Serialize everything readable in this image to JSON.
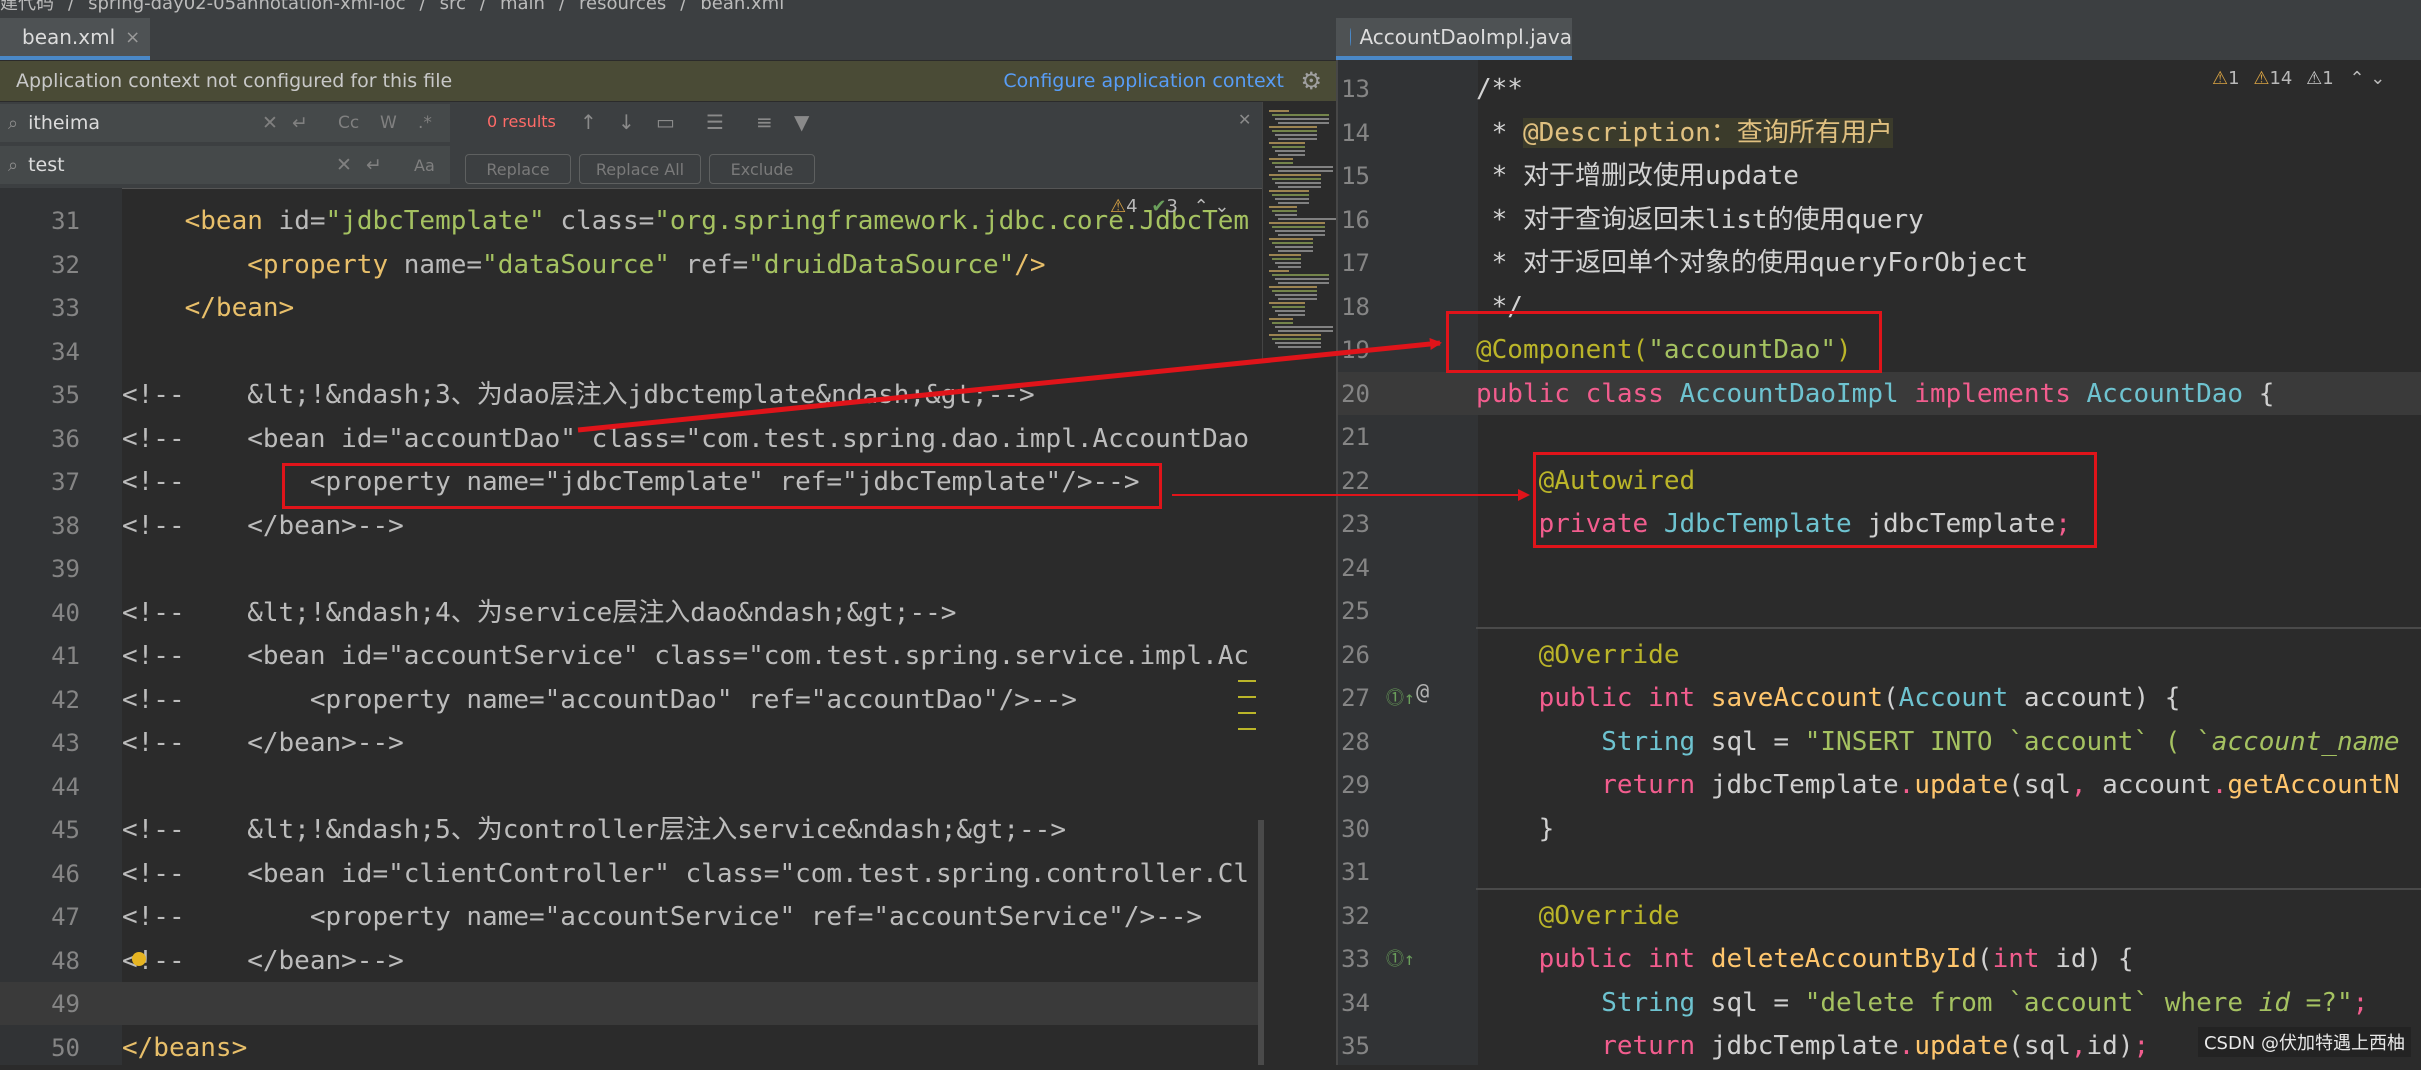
{
  "breadcrumb": [
    "建代码",
    "spring-day02-05annotation-xml-ioc",
    "src",
    "main",
    "resources",
    "bean.xml"
  ],
  "tabs_left": [
    {
      "label": "bean.xml",
      "close": "×"
    }
  ],
  "tabs_right": [
    {
      "label": "AccountDaoImpl.java"
    }
  ],
  "notice": {
    "message": "Application context not configured for this file",
    "action": "Configure application context",
    "gear": "gear-icon"
  },
  "search": {
    "find_value": "itheima",
    "replace_value": "test",
    "results": "0 results",
    "match_case": "Cc",
    "words": "W",
    "regex": ".*",
    "buttons": {
      "replace": "Replace",
      "replace_all": "Replace All",
      "exclude": "Exclude"
    }
  },
  "left_inspection": {
    "warnings": "4",
    "ok": "3"
  },
  "right_inspection": {
    "a": "1",
    "b": "14",
    "c": "1"
  },
  "left_lines": [
    {
      "n": "31",
      "segs": [
        [
          "t-tag",
          "    <bean "
        ],
        [
          "t-attr",
          "id="
        ],
        [
          "t-str",
          "\"jdbcTemplate\""
        ],
        [
          "t-attr",
          " class="
        ],
        [
          "t-str",
          "\"org.springframework.jdbc.core.JdbcTem"
        ]
      ]
    },
    {
      "n": "32",
      "segs": [
        [
          "t-tag",
          "        <property "
        ],
        [
          "t-attr",
          "name="
        ],
        [
          "t-str",
          "\"dataSource\""
        ],
        [
          "t-attr",
          " ref="
        ],
        [
          "t-str",
          "\"druidDataSource\""
        ],
        [
          "t-tag",
          "/>"
        ]
      ]
    },
    {
      "n": "33",
      "segs": [
        [
          "t-tag",
          "    </bean>"
        ]
      ]
    },
    {
      "n": "34",
      "segs": []
    },
    {
      "n": "35",
      "segs": [
        [
          "t-cmt",
          "<!--    &lt;!&ndash;3、为dao层注入jdbctemplate&ndash;&gt;-->"
        ]
      ]
    },
    {
      "n": "36",
      "segs": [
        [
          "t-cmt",
          "<!--    <bean id=\"accountDao\" class=\"com.test.spring.dao.impl.AccountDao"
        ]
      ]
    },
    {
      "n": "37",
      "segs": [
        [
          "t-cmt",
          "<!--        <property name=\"jdbcTemplate\" ref=\"jdbcTemplate\"/>-->"
        ]
      ]
    },
    {
      "n": "38",
      "segs": [
        [
          "t-cmt",
          "<!--    </bean>-->"
        ]
      ]
    },
    {
      "n": "39",
      "segs": []
    },
    {
      "n": "40",
      "segs": [
        [
          "t-cmt",
          "<!--    &lt;!&ndash;4、为service层注入dao&ndash;&gt;-->"
        ]
      ]
    },
    {
      "n": "41",
      "segs": [
        [
          "t-cmt",
          "<!--    <bean id=\"accountService\" class=\"com.test.spring.service.impl.Ac"
        ]
      ]
    },
    {
      "n": "42",
      "segs": [
        [
          "t-cmt",
          "<!--        <property name=\"accountDao\" ref=\"accountDao\"/>-->"
        ]
      ]
    },
    {
      "n": "43",
      "segs": [
        [
          "t-cmt",
          "<!--    </bean>-->"
        ]
      ]
    },
    {
      "n": "44",
      "segs": []
    },
    {
      "n": "45",
      "segs": [
        [
          "t-cmt",
          "<!--    &lt;!&ndash;5、为controller层注入service&ndash;&gt;-->"
        ]
      ]
    },
    {
      "n": "46",
      "segs": [
        [
          "t-cmt",
          "<!--    <bean id=\"clientController\" class=\"com.test.spring.controller.Cl"
        ]
      ]
    },
    {
      "n": "47",
      "segs": [
        [
          "t-cmt",
          "<!--        <property name=\"accountService\" ref=\"accountService\"/>-->"
        ]
      ]
    },
    {
      "n": "48",
      "segs": [
        [
          "t-cmt",
          "<!--    </bean>-->"
        ]
      ]
    },
    {
      "n": "49",
      "segs": []
    },
    {
      "n": "50",
      "segs": [
        [
          "t-tag",
          "</beans>"
        ]
      ]
    }
  ],
  "right_lines": [
    {
      "n": "13",
      "segs": [
        [
          "t-doc",
          "/**"
        ]
      ]
    },
    {
      "n": "14",
      "segs": [
        [
          "t-doc",
          " * "
        ],
        [
          "t-doctag",
          "@Description：查询所有用户"
        ]
      ]
    },
    {
      "n": "15",
      "segs": [
        [
          "t-doc",
          " * 对于增删改使用update"
        ]
      ]
    },
    {
      "n": "16",
      "segs": [
        [
          "t-doc",
          " * 对于查询返回未list的使用query"
        ]
      ]
    },
    {
      "n": "17",
      "segs": [
        [
          "t-doc",
          " * 对于返回单个对象的使用queryForObject"
        ]
      ]
    },
    {
      "n": "18",
      "segs": [
        [
          "t-doc",
          " */"
        ]
      ]
    },
    {
      "n": "19",
      "segs": [
        [
          "t-ann",
          "@Component("
        ],
        [
          "t-str",
          "\"accountDao\""
        ],
        [
          "t-ann",
          ")"
        ]
      ]
    },
    {
      "n": "20",
      "segs": [
        [
          "t-pink",
          "public class "
        ],
        [
          "t-type",
          "AccountDaoImpl"
        ],
        [
          "t-pink",
          " implements "
        ],
        [
          "t-type",
          "AccountDao"
        ],
        [
          "t-punc",
          " {"
        ]
      ]
    },
    {
      "n": "21",
      "segs": []
    },
    {
      "n": "22",
      "segs": [
        [
          "t-ann",
          "    @Autowired"
        ]
      ]
    },
    {
      "n": "23",
      "segs": [
        [
          "t-pink",
          "    private "
        ],
        [
          "t-type",
          "JdbcTemplate"
        ],
        [
          "t-field",
          " jdbcTemplate"
        ],
        [
          "t-pink",
          ";"
        ]
      ]
    },
    {
      "n": "24",
      "segs": []
    },
    {
      "n": "25",
      "segs": []
    },
    {
      "n": "26",
      "segs": [
        [
          "t-ann",
          "    @Override"
        ]
      ]
    },
    {
      "n": "27",
      "segs": [
        [
          "t-pink",
          "    public int "
        ],
        [
          "t-fn",
          "saveAccount"
        ],
        [
          "t-punc",
          "("
        ],
        [
          "t-type",
          "Account"
        ],
        [
          "t-field",
          " account) {"
        ]
      ]
    },
    {
      "n": "28",
      "segs": [
        [
          "t-type",
          "        String"
        ],
        [
          "t-field",
          " sql = "
        ],
        [
          "t-str",
          "\"INSERT INTO `account` ( `"
        ],
        [
          "t-str t-italic",
          "account_name"
        ]
      ]
    },
    {
      "n": "29",
      "segs": [
        [
          "t-pink",
          "        return "
        ],
        [
          "t-field",
          "jdbcTemplate"
        ],
        [
          "t-pink",
          "."
        ],
        [
          "t-fn",
          "update"
        ],
        [
          "t-field",
          "(sql"
        ],
        [
          "t-pink",
          ", "
        ],
        [
          "t-field",
          "account"
        ],
        [
          "t-pink",
          "."
        ],
        [
          "t-fn",
          "getAccountN"
        ]
      ]
    },
    {
      "n": "30",
      "segs": [
        [
          "t-punc",
          "    }"
        ]
      ]
    },
    {
      "n": "31",
      "segs": []
    },
    {
      "n": "32",
      "segs": [
        [
          "t-ann",
          "    @Override"
        ]
      ]
    },
    {
      "n": "33",
      "segs": [
        [
          "t-pink",
          "    public int "
        ],
        [
          "t-fn",
          "deleteAccountById"
        ],
        [
          "t-punc",
          "("
        ],
        [
          "t-pink",
          "int "
        ],
        [
          "t-field",
          "id) {"
        ]
      ]
    },
    {
      "n": "34",
      "segs": [
        [
          "t-type",
          "        String"
        ],
        [
          "t-field",
          " sql = "
        ],
        [
          "t-str",
          "\"delete from `account` where "
        ],
        [
          "t-str t-italic",
          "id"
        ],
        [
          "t-str",
          " =?\""
        ],
        [
          "t-pink",
          ";"
        ]
      ]
    },
    {
      "n": "35",
      "segs": [
        [
          "t-pink",
          "        return "
        ],
        [
          "t-field",
          "jdbcTemplate"
        ],
        [
          "t-pink",
          "."
        ],
        [
          "t-fn",
          "update"
        ],
        [
          "t-field",
          "(sql"
        ],
        [
          "t-pink",
          ","
        ],
        [
          "t-field",
          "id)"
        ],
        [
          "t-pink",
          ";"
        ]
      ]
    }
  ],
  "watermark": "CSDN @伏加特遇上西柚",
  "colors": {
    "redbox": "#e0141a",
    "accent": "#4a88c7"
  }
}
